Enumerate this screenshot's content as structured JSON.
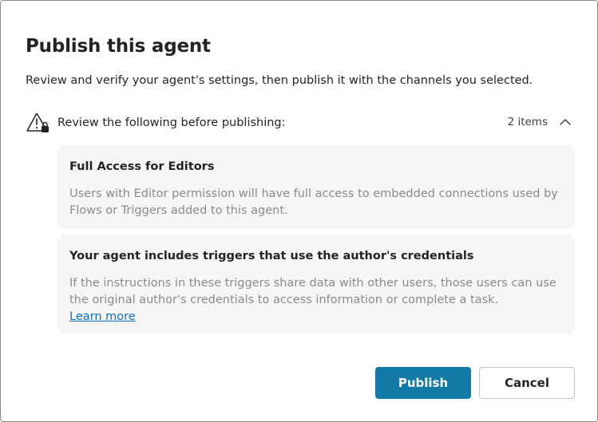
{
  "dialog": {
    "title": "Publish this agent",
    "subtitle": "Review and verify your agent's settings, then publish it with the channels you selected."
  },
  "review": {
    "label": "Review the following before publishing:",
    "count": "2 items",
    "warning_icon": "warning-lock-icon",
    "chevron_icon": "chevron-up-icon",
    "items": [
      {
        "title": "Full Access for Editors",
        "body": "Users with Editor permission will have full access to embedded connections used by Flows or Triggers added to this agent."
      },
      {
        "title": "Your agent includes triggers that use the author's credentials",
        "body": "If the instructions in these triggers share data with other users, those users can use the original author's credentials to access information or complete a task.",
        "link": "Learn more"
      }
    ]
  },
  "buttons": {
    "publish": "Publish",
    "cancel": "Cancel"
  },
  "colors": {
    "primary": "#117aa6",
    "link": "#0f6cbd",
    "card_bg": "#f7f6f5",
    "muted_text": "#8a8a8a"
  }
}
